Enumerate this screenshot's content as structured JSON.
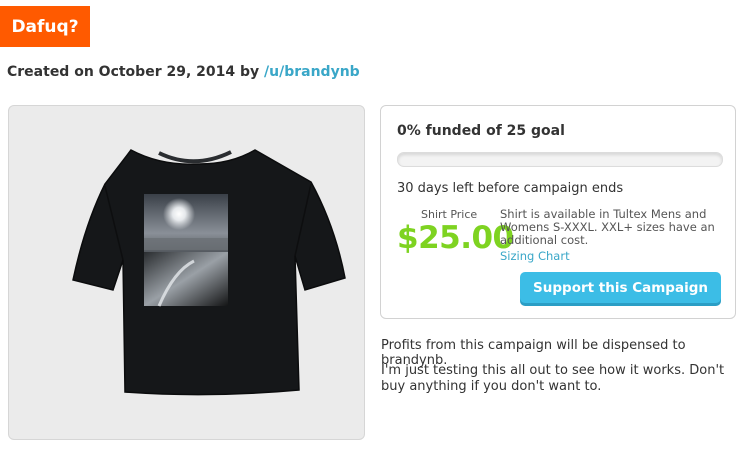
{
  "header": {
    "title": "Dafuq?",
    "created_prefix": "Created on October 29, 2014 by",
    "author_link": "/u/brandynb"
  },
  "product": {
    "image_label": "tshirt-photo-print"
  },
  "campaign": {
    "funded_text": "0% funded of 25 goal",
    "funded_fraction": 0.0,
    "days_text": "30 days left before campaign ends",
    "price_label": "Shirt Price",
    "price": "$25.00",
    "price_note": "Shirt is available in Tultex Mens and Womens S-XXXL. XXL+ sizes have an additional cost.",
    "sizing_link": "Sizing Chart",
    "support_label": "Support this Campaign"
  },
  "details": {
    "profits_text": "Profits from this campaign will be dispensed to brandynb.",
    "description": "I'm just testing this all out to see how it works. Don't buy anything if you don't want to."
  },
  "colors": {
    "badge": "#ff5a00",
    "accent": "#3aa7c8",
    "price_green": "#7ed321",
    "button": "#3cbde6"
  }
}
